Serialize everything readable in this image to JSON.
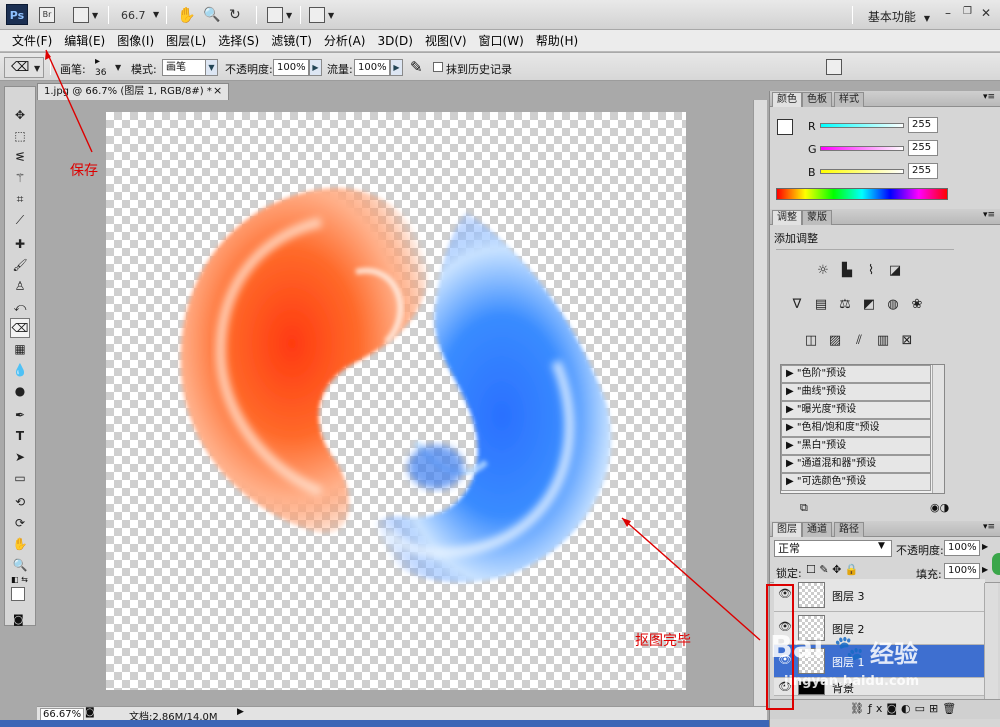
{
  "app": {
    "logo": "Ps",
    "bridge_label": "Br",
    "zoom_value": "66.7",
    "workspace": "基本功能"
  },
  "menu": [
    "文件(F)",
    "编辑(E)",
    "图像(I)",
    "图层(L)",
    "选择(S)",
    "滤镜(T)",
    "分析(A)",
    "3D(D)",
    "视图(V)",
    "窗口(W)",
    "帮助(H)"
  ],
  "options": {
    "brush_label": "画笔:",
    "brush_size": "36",
    "mode_label": "模式:",
    "mode_value": "画笔",
    "opacity_label": "不透明度:",
    "opacity_value": "100%",
    "flow_label": "流量:",
    "flow_value": "100%",
    "history_label": "抹到历史记录"
  },
  "document": {
    "tab_title": "1.jpg @ 66.7% (图层 1, RGB/8#) *",
    "close": "×",
    "status_zoom": "66.67%",
    "status_doc": "文档:2.86M/14.0M"
  },
  "panels": {
    "color_tabs": [
      "颜色",
      "色板",
      "样式"
    ],
    "rgb": [
      {
        "label": "R",
        "value": "255"
      },
      {
        "label": "G",
        "value": "255"
      },
      {
        "label": "B",
        "value": "255"
      }
    ],
    "adjust_tabs": [
      "调整",
      "蒙版"
    ],
    "adjust_title": "添加调整",
    "presets": [
      "\"色阶\"预设",
      "\"曲线\"预设",
      "\"曝光度\"预设",
      "\"色相/饱和度\"预设",
      "\"黑白\"预设",
      "\"通道混和器\"预设",
      "\"可选颜色\"预设"
    ],
    "layers_tabs": [
      "图层",
      "通道",
      "路径"
    ],
    "blend_mode": "正常",
    "opacity_label": "不透明度:",
    "opacity_value": "100%",
    "lock_label": "锁定:",
    "fill_label": "填充:",
    "fill_value": "100%",
    "layers": [
      {
        "name": "图层 3",
        "selected": false
      },
      {
        "name": "图层 2",
        "selected": false
      },
      {
        "name": "图层 1",
        "selected": true
      },
      {
        "name": "背景",
        "selected": false
      }
    ]
  },
  "annotations": {
    "save": "保存",
    "done": "抠图完毕"
  },
  "watermark": {
    "brand": "Bai",
    "brand2": "经验",
    "url": "jingyan.baidu.com"
  }
}
